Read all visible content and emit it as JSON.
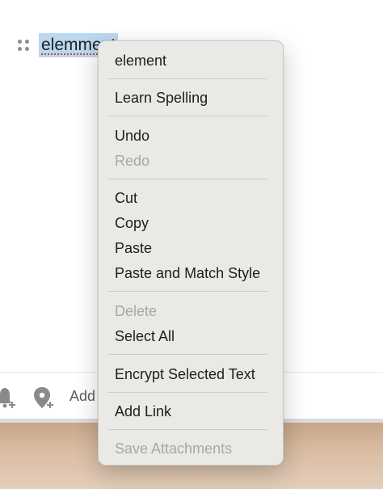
{
  "editor": {
    "selected_text": "elemment"
  },
  "toolbar": {
    "add_label": "Add",
    "icons": [
      "bell-plus-icon",
      "location-plus-icon"
    ]
  },
  "context_menu": {
    "spelling_suggestion": "element",
    "learn_spelling": "Learn Spelling",
    "undo": "Undo",
    "redo": "Redo",
    "cut": "Cut",
    "copy": "Copy",
    "paste": "Paste",
    "paste_match_style": "Paste and Match Style",
    "delete": "Delete",
    "select_all": "Select All",
    "encrypt": "Encrypt Selected Text",
    "add_link": "Add Link",
    "save_attachments": "Save Attachments",
    "disabled_items": [
      "Redo",
      "Delete",
      "Save Attachments"
    ]
  },
  "colors": {
    "selection": "#bcd8ef",
    "menu_background": "#ebe9e6",
    "disabled_text": "#a9a7a4",
    "spelling_underline": "#d3463b"
  }
}
